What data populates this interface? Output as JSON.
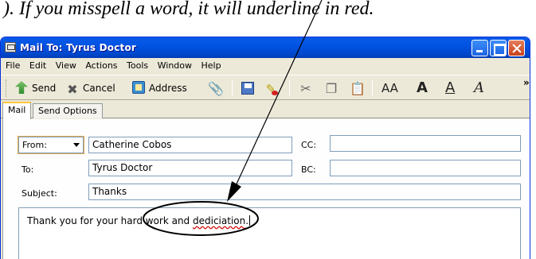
{
  "document": {
    "visible_text": "). If you misspell a word, it will underline in red."
  },
  "window": {
    "title": "Mail To: Tyrus Doctor"
  },
  "menu": [
    "File",
    "Edit",
    "View",
    "Actions",
    "Tools",
    "Window",
    "Help"
  ],
  "toolbar": {
    "send_label": "Send",
    "cancel_label": "Cancel",
    "address_label": "Address",
    "icons": [
      "send-icon",
      "cancel-icon",
      "address-book-icon",
      "paperclip-icon",
      "save-icon",
      "spellcheck-icon",
      "cut-icon",
      "copy-icon",
      "paste-icon",
      "font-size-icon",
      "bold-icon",
      "underline-icon",
      "italic-icon"
    ],
    "font_glyphs": {
      "font_size": "AA",
      "bold": "A",
      "underline": "A",
      "italic": "A"
    },
    "overflow": "»"
  },
  "tabs": [
    "Mail",
    "Send Options"
  ],
  "form": {
    "from_label": "From:",
    "from_value": "Catherine Cobos",
    "to_label": "To:",
    "to_value": "Tyrus Doctor",
    "cc_label": "CC:",
    "cc_value": "",
    "bc_label": "BC:",
    "bc_value": "",
    "subject_label": "Subject:",
    "subject_value": "Thanks"
  },
  "message": {
    "text_before": "Thank you for your hard work and ",
    "misspelled_word": "dediciation",
    "text_after": "."
  },
  "colors": {
    "titlebar": "#0053e3",
    "close_button": "#c7411c",
    "misspell_underline": "#d40000",
    "active_tab_accent": "#ffc73c"
  }
}
